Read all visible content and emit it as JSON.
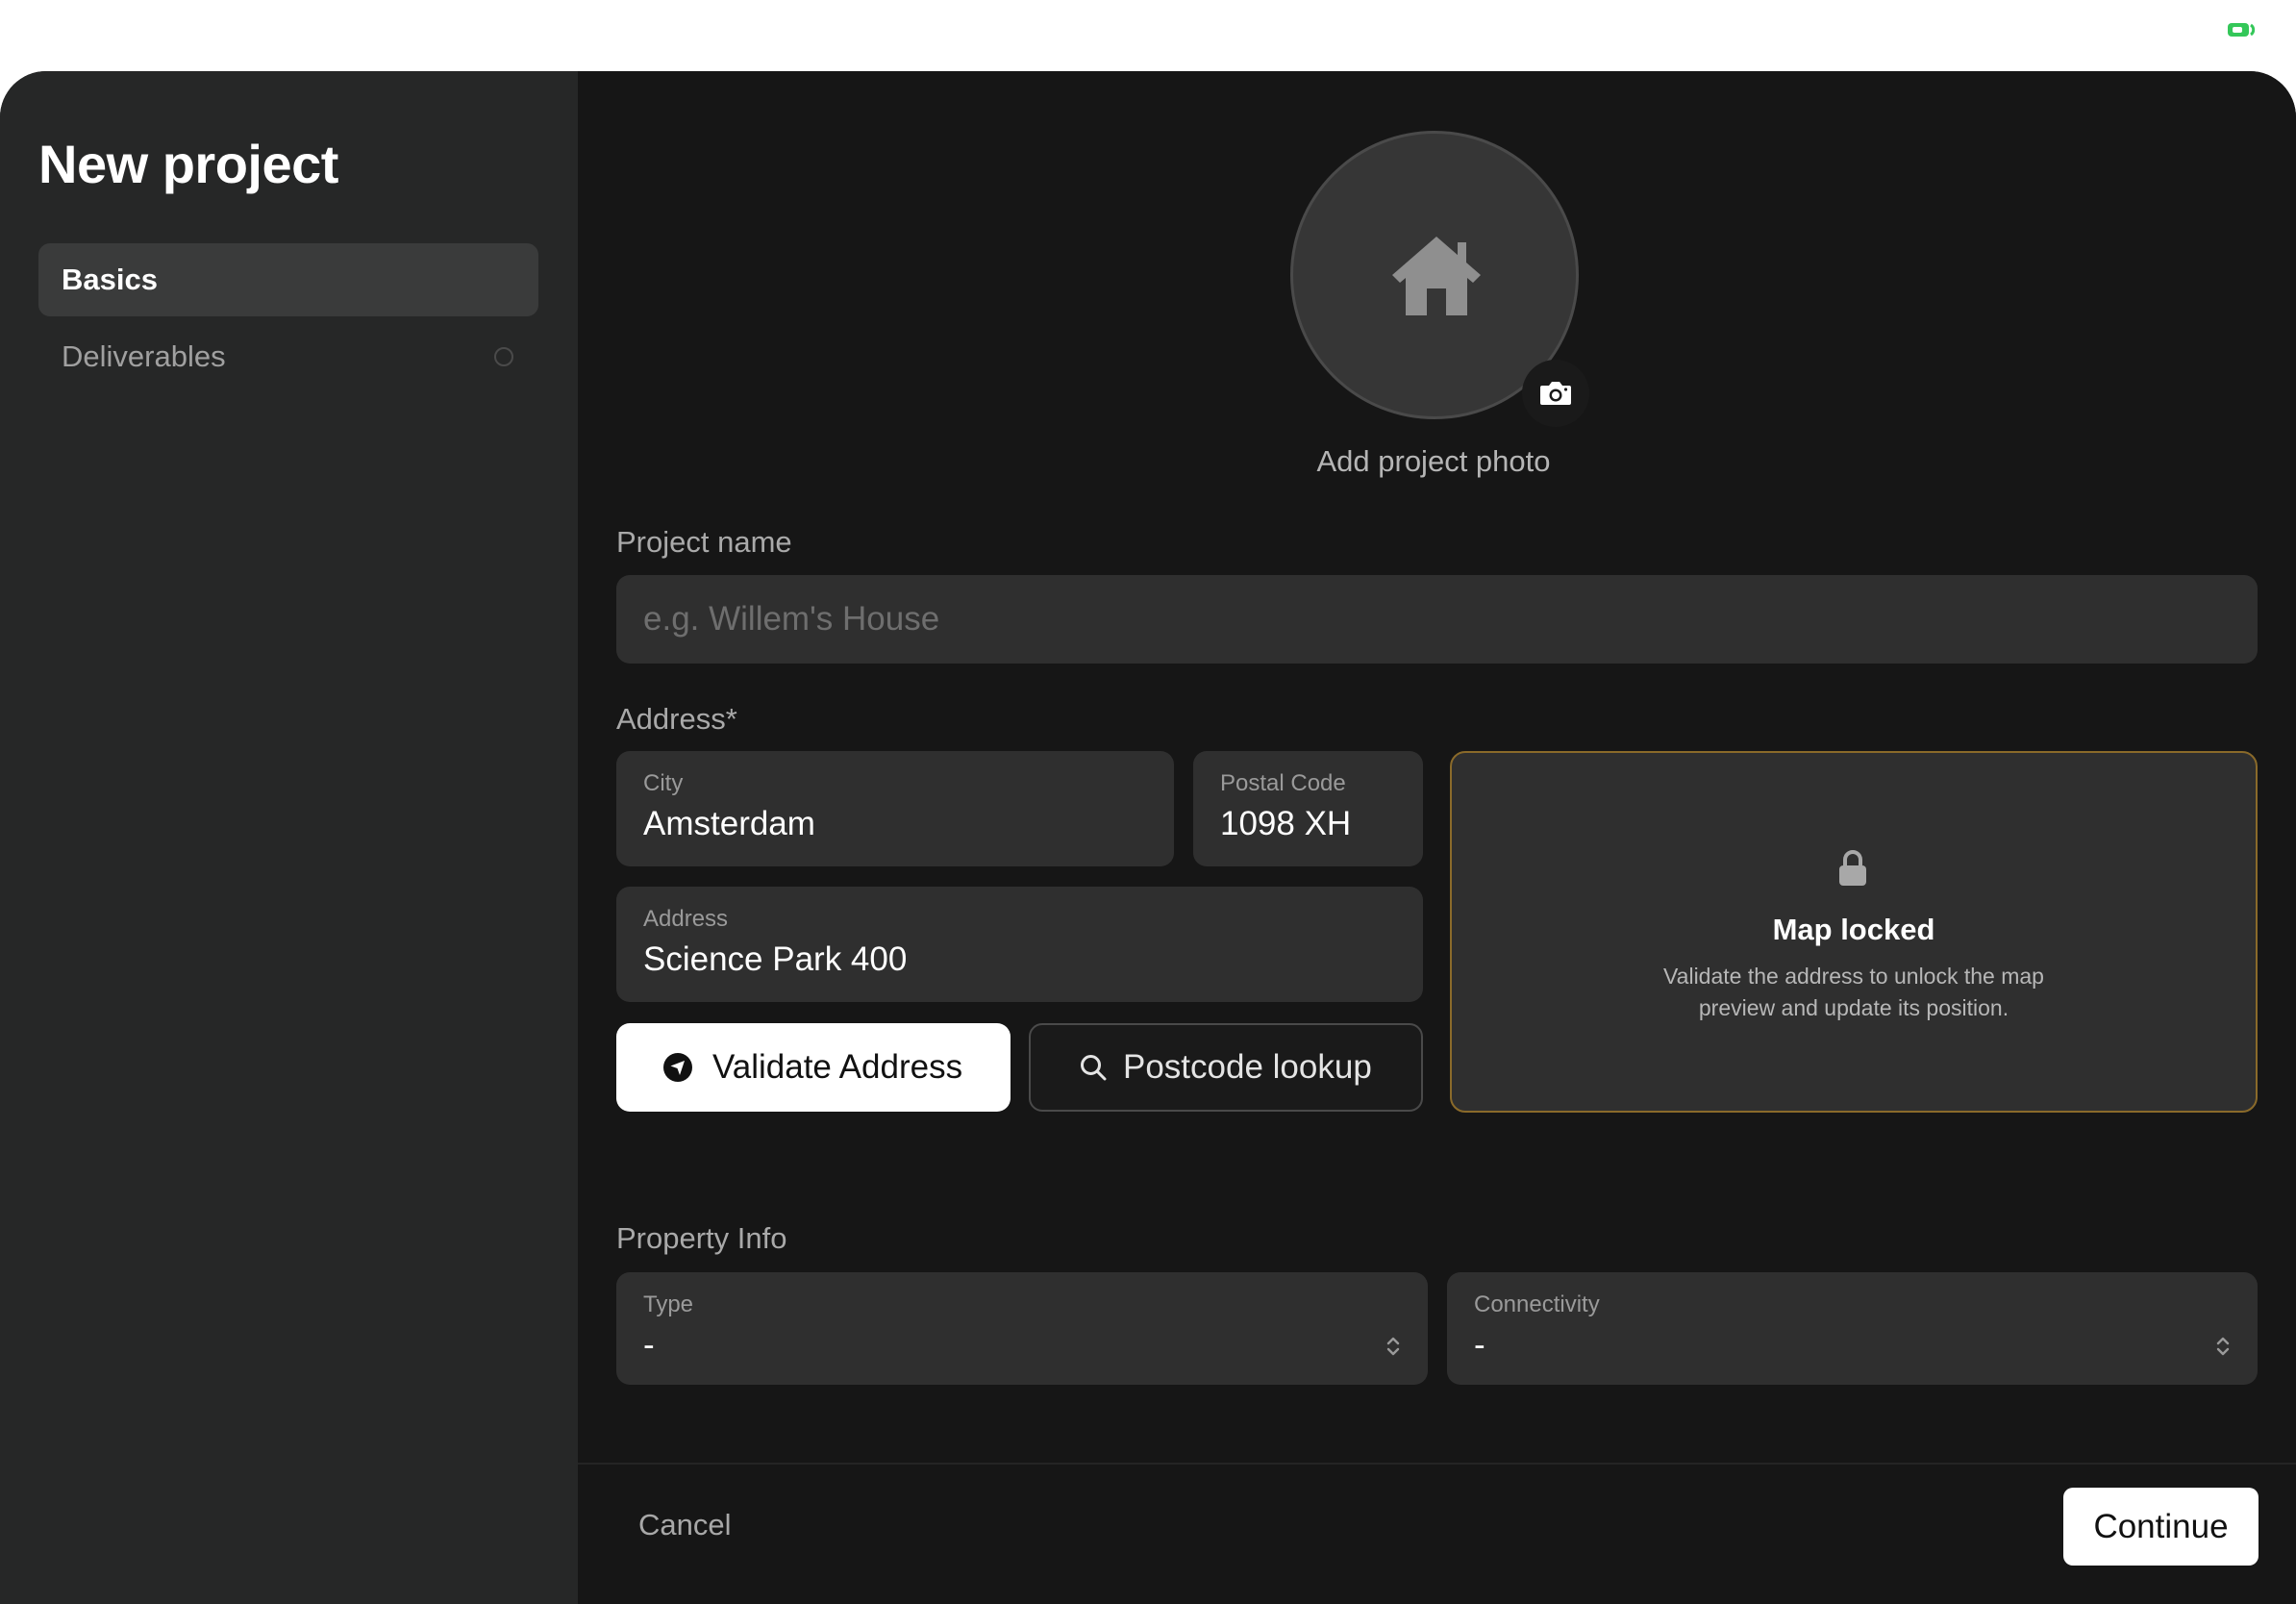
{
  "status": {
    "battery_color": "#34c759"
  },
  "sidebar": {
    "title": "New project",
    "items": [
      {
        "label": "Basics",
        "active": true
      },
      {
        "label": "Deliverables",
        "active": false
      }
    ]
  },
  "photo": {
    "label": "Add project photo",
    "icon": "house-icon",
    "badge_icon": "camera-icon"
  },
  "project_name": {
    "label": "Project name",
    "placeholder": "e.g. Willem's House",
    "value": ""
  },
  "address": {
    "label": "Address*",
    "city": {
      "label": "City",
      "value": "Amsterdam"
    },
    "postal_code": {
      "label": "Postal Code",
      "value": "1098 XH"
    },
    "street": {
      "label": "Address",
      "value": "Science Park 400"
    },
    "validate_label": "Validate Address",
    "lookup_label": "Postcode lookup"
  },
  "map": {
    "title": "Map locked",
    "description_line1": "Validate the address to unlock the map",
    "description_line2": "preview and update its position.",
    "border_color": "#8a6a2a"
  },
  "property": {
    "label": "Property Info",
    "type": {
      "label": "Type",
      "value": "-"
    },
    "connectivity": {
      "label": "Connectivity",
      "value": "-"
    }
  },
  "footer": {
    "cancel_label": "Cancel",
    "continue_label": "Continue"
  }
}
